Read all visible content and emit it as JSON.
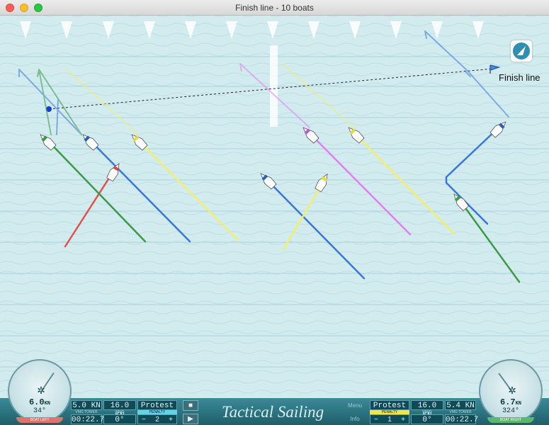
{
  "window": {
    "title": "Finish line - 10 boats"
  },
  "course": {
    "finish_label": "Finish line"
  },
  "colors": {
    "water": "#cfe9ee",
    "accent": "#1f5e6a",
    "penalty": "#5fd3e8",
    "protest": "#f2e34a"
  },
  "left_panel": {
    "boat_speed": "5.0 KN",
    "boat_speed_caption": "VMG TOWER",
    "wind_speed": "16.0 KN",
    "wind_speed_caption": "WIND",
    "protest_label": "Protest",
    "penalty_caption": "PENALTY",
    "timer": "00:22.7",
    "angle": "0°",
    "penalty_value": "2",
    "minus": "−",
    "plus": "+",
    "stop_icon": "■",
    "play_icon": "▶"
  },
  "right_panel": {
    "menu_label": "Menu",
    "info_label": "Info",
    "protest_label": "Protest",
    "penalty_caption": "PENALTY",
    "wind_speed": "16.0 KN",
    "wind_speed_caption": "WIND",
    "boat_speed": "5.4 KN",
    "boat_speed_caption": "VMG TOWER",
    "penalty_value": "1",
    "angle": "0°",
    "timer": "00:22.7",
    "minus": "−",
    "plus": "+"
  },
  "brand": {
    "text": "Tactical Sailing"
  },
  "gauge_left": {
    "speed": "6.0",
    "unit": "KN",
    "heading": "34°",
    "caption": "BOAT LEFT",
    "needle_deg": 34
  },
  "gauge_right": {
    "speed": "6.7",
    "unit": "KN",
    "heading": "324°",
    "caption": "BOAT RIGHT",
    "needle_deg": -36
  }
}
